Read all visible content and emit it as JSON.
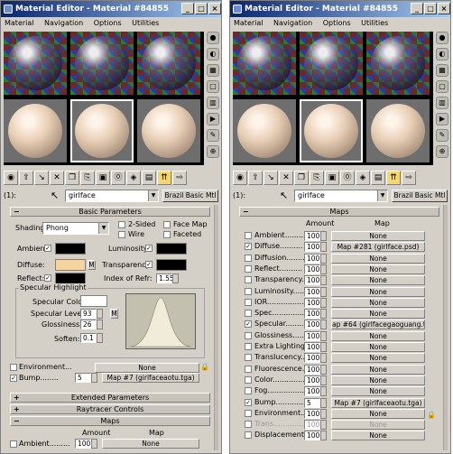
{
  "windows": [
    {
      "title": "Material Editor - Material #84855",
      "menu": [
        "Material",
        "Navigation",
        "Options",
        "Utilities"
      ],
      "material_index": "(1):",
      "material_name": "girlface",
      "material_type": "Brazil Basic Mtl",
      "rollouts": {
        "basic_parameters": "Basic Parameters",
        "extended_parameters": "Extended Parameters",
        "raytracer_controls": "Raytracer Controls",
        "maps": "Maps"
      },
      "shading": {
        "label": "Shading:",
        "value": "Phong",
        "two_sided": "2-Sided",
        "wire": "Wire",
        "face_map": "Face Map",
        "faceted": "Faceted"
      },
      "colors": {
        "ambient_label": "Ambient:",
        "diffuse_label": "Diffuse:",
        "reflect_label": "Reflect:",
        "luminosity_label": "Luminosity:",
        "transparency_label": "Transparency:",
        "ior_label": "Index of Refr:",
        "ior_value": "1.55",
        "m_label": "M",
        "ambient_color": "#000000",
        "diffuse_color": "#f5d4a0",
        "reflect_color": "#000000",
        "luminosity_color": "#000000",
        "transparency_color": "#000000"
      },
      "specular": {
        "group_label": "Specular Highlight",
        "specular_color_label": "Specular Color:",
        "specular_color": "#ffffff",
        "level_label": "Specular Level:",
        "level_value": "93",
        "gloss_label": "Glossiness:",
        "gloss_value": "26",
        "soften_label": "Soften:",
        "soften_value": "0.1",
        "m_label": "M"
      },
      "environment": {
        "label": "Environment...",
        "map": "None"
      },
      "bump": {
        "label": "Bump........",
        "amount": "5",
        "map": "Map #7 (girlfaceaotu.tga)"
      },
      "maps_header": {
        "amount": "Amount",
        "map": "Map"
      },
      "maps_first_row": {
        "label": "Ambient.........",
        "amount": "100",
        "map": "None"
      }
    },
    {
      "title": "Material Editor - Material #84855",
      "menu": [
        "Material",
        "Navigation",
        "Options",
        "Utilities"
      ],
      "material_index": "(1):",
      "material_name": "girlface",
      "material_type": "Brazil Basic Mtl",
      "maps_rollout": "Maps",
      "maps_header": {
        "amount": "Amount",
        "map": "Map"
      },
      "maps": [
        {
          "label": "Ambient.........",
          "amount": "100",
          "map": "None",
          "checked": false
        },
        {
          "label": "Diffuse..........",
          "amount": "100",
          "map": "Map #281 (girlface.psd)",
          "checked": true
        },
        {
          "label": "Diffusion.........",
          "amount": "100",
          "map": "None",
          "checked": false
        },
        {
          "label": "Reflect..........",
          "amount": "100",
          "map": "None",
          "checked": false
        },
        {
          "label": "Transparency....",
          "amount": "100",
          "map": "None",
          "checked": false
        },
        {
          "label": "Luminosity......",
          "amount": "100",
          "map": "None",
          "checked": false
        },
        {
          "label": "IOR.................",
          "amount": "100",
          "map": "None",
          "checked": false
        },
        {
          "label": "Spec................",
          "amount": "100",
          "map": "None",
          "checked": false
        },
        {
          "label": "Specular...........",
          "amount": "100",
          "map": "ap #64 (girlfacegaoguang.tga)",
          "checked": true
        },
        {
          "label": "Glossiness........",
          "amount": "100",
          "map": "None",
          "checked": false
        },
        {
          "label": "Extra Lighting....",
          "amount": "100",
          "map": "None",
          "checked": false
        },
        {
          "label": "Translucency......",
          "amount": "100",
          "map": "None",
          "checked": false
        },
        {
          "label": "Fluorescence.....",
          "amount": "100",
          "map": "None",
          "checked": false
        },
        {
          "label": "Color................",
          "amount": "100",
          "map": "None",
          "checked": false
        },
        {
          "label": "Fog.................",
          "amount": "100",
          "map": "None",
          "checked": false
        },
        {
          "label": "Bump...............",
          "amount": "5",
          "map": "Map #7 (girlfaceaotu.tga)",
          "checked": true
        },
        {
          "label": "Environment......",
          "amount": "100",
          "map": "None",
          "checked": false
        },
        {
          "label": "Trans...............",
          "amount": "100",
          "map": "None",
          "checked": false,
          "disabled": true
        },
        {
          "label": "Displacement.....",
          "amount": "100",
          "map": "None",
          "checked": false
        }
      ]
    }
  ]
}
